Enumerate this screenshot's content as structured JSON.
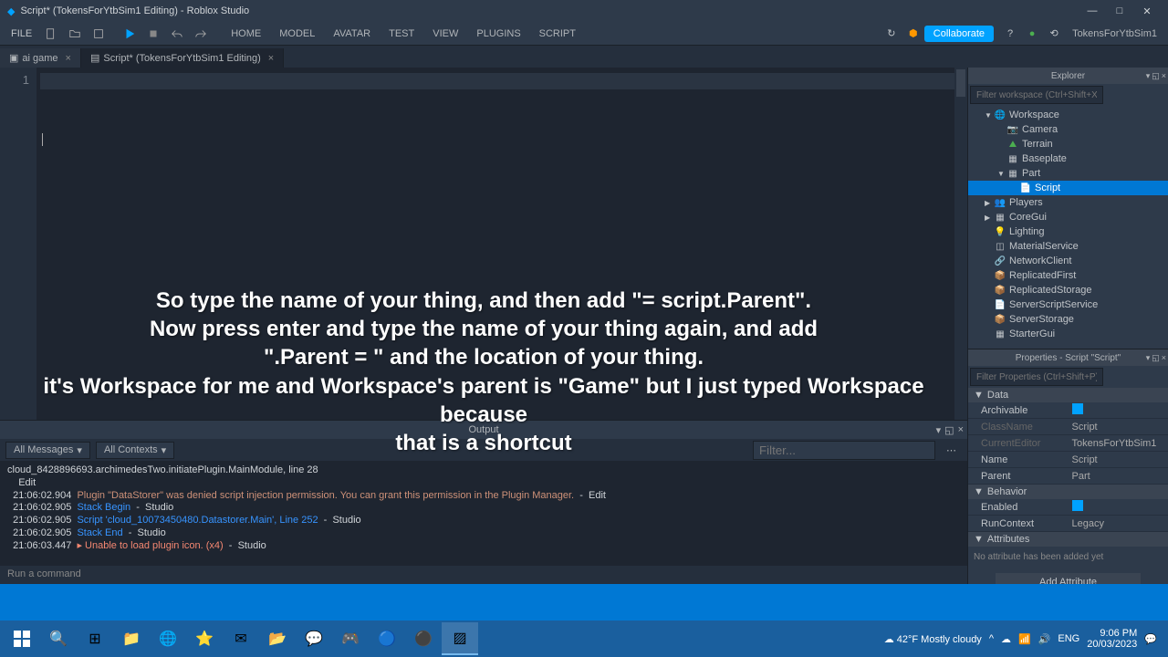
{
  "window": {
    "title": "Script* (TokensForYtbSim1 Editing) - Roblox Studio"
  },
  "menubar": {
    "file": "FILE",
    "tabs": [
      "HOME",
      "MODEL",
      "AVATAR",
      "TEST",
      "VIEW",
      "PLUGINS",
      "SCRIPT"
    ],
    "collaborate": "Collaborate",
    "username": "TokensForYtbSim1"
  },
  "doctabs": {
    "tab1": "ai game",
    "tab2": "Script* (TokensForYtbSim1 Editing)"
  },
  "editor": {
    "line1": "1"
  },
  "overlay": {
    "l1": "So type the name of your thing, and then add \"= script.Parent\".",
    "l2": "Now press enter and type the name of your thing again, and add",
    "l3": "\".Parent = \" and the location of your thing.",
    "l4": "it's Workspace for me and Workspace's parent is \"Game\" but I just typed Workspace because",
    "l5": "that is a shortcut"
  },
  "output": {
    "title": "Output",
    "allmsg": "All Messages",
    "allctx": "All Contexts",
    "filter_ph": "Filter...",
    "lines": {
      "l0": "cloud_8428896693.archimedesTwo.initiatePlugin.MainModule, line 28",
      "l1a": "    Edit",
      "l1t": "  21:06:02.904",
      "l1m": "  Plugin \"DataStorer\" was denied script injection permission. You can grant this permission in the Plugin Manager.",
      "l1s": "  -  Edit",
      "l2t": "  21:06:02.905",
      "l2m": "  Stack Begin",
      "l2s": "  -  Studio",
      "l3t": "  21:06:02.905",
      "l3m": "  Script 'cloud_10073450480.Datastorer.Main', Line 252",
      "l3s": "  -  Studio",
      "l4t": "  21:06:02.905",
      "l4m": "  Stack End",
      "l4s": "  -  Studio",
      "l5t": "  21:06:03.447",
      "l5m": "  ▸ Unable to load plugin icon. (x4)",
      "l5s": "  -  Studio"
    },
    "cmd_ph": "Run a command"
  },
  "explorer": {
    "title": "Explorer",
    "filter_ph": "Filter workspace (Ctrl+Shift+X)",
    "nodes": {
      "workspace": "Workspace",
      "camera": "Camera",
      "terrain": "Terrain",
      "baseplate": "Baseplate",
      "part": "Part",
      "script": "Script",
      "players": "Players",
      "coregui": "CoreGui",
      "lighting": "Lighting",
      "materialservice": "MaterialService",
      "networkclient": "NetworkClient",
      "replicatedfirst": "ReplicatedFirst",
      "replicatedstorage": "ReplicatedStorage",
      "serverscriptservice": "ServerScriptService",
      "serverstorage": "ServerStorage",
      "startergui": "StarterGui"
    }
  },
  "properties": {
    "title": "Properties - Script \"Script\"",
    "filter_ph": "Filter Properties (Ctrl+Shift+P)",
    "sections": {
      "data": "Data",
      "behavior": "Behavior",
      "attributes": "Attributes"
    },
    "rows": {
      "archivable": "Archivable",
      "classname": "ClassName",
      "classname_v": "Script",
      "currenteditor": "CurrentEditor",
      "currenteditor_v": "TokensForYtbSim1",
      "name": "Name",
      "name_v": "Script",
      "parent": "Parent",
      "parent_v": "Part",
      "enabled": "Enabled",
      "runcontext": "RunContext",
      "runcontext_v": "Legacy"
    },
    "noattr": "No attribute has been added yet",
    "addattr": "Add Attribute"
  },
  "taskbar": {
    "weather": "42°F Mostly cloudy",
    "lang": "ENG",
    "time": "9:06 PM",
    "date": "20/03/2023"
  }
}
